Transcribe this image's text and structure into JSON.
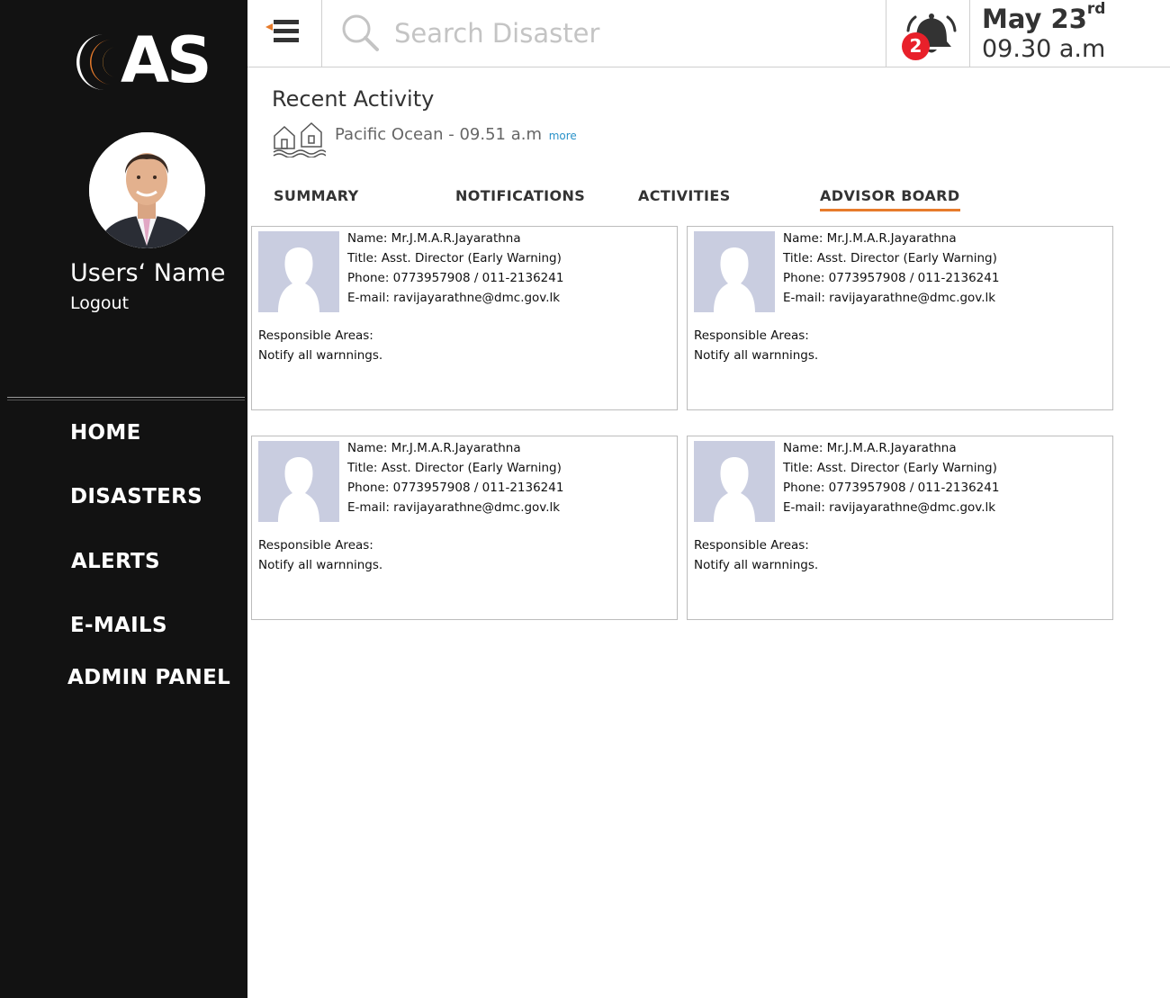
{
  "app": {
    "logo_text": "AS",
    "accent_color": "#e77b2b"
  },
  "sidebar": {
    "user_name": "Users‘  Name",
    "logout_label": "Logout",
    "nav": [
      {
        "label": "HOME"
      },
      {
        "label": "DISASTERS"
      },
      {
        "label": "ALERTS"
      },
      {
        "label": "E-MAILS"
      },
      {
        "label": "ADMIN PANEL"
      }
    ]
  },
  "header": {
    "search_placeholder": "Search Disaster",
    "notification_count": "2",
    "date_main": "May 23",
    "date_suffix": "rd",
    "time": "09.30 a.m"
  },
  "recent_activity": {
    "title": "Recent Activity",
    "item_text": "Pacific Ocean - 09.51 a.m",
    "more_label": "more"
  },
  "tabs": [
    {
      "label": "SUMMARY",
      "active": false
    },
    {
      "label": "NOTIFICATIONS",
      "active": false
    },
    {
      "label": "ACTIVITIES",
      "active": false
    },
    {
      "label": "ADVISOR BOARD",
      "active": true
    }
  ],
  "advisors": [
    {
      "name": "Name: Mr.J.M.A.R.Jayarathna",
      "title": "Title: Asst. Director (Early Warning)",
      "phone": "Phone: 0773957908 / 011-2136241",
      "email": "E-mail: ravijayarathne@dmc.gov.lk",
      "areas_label": "Responsible Areas:",
      "areas": "Notify all warnnings."
    },
    {
      "name": "Name: Mr.J.M.A.R.Jayarathna",
      "title": "Title: Asst. Director (Early Warning)",
      "phone": "Phone: 0773957908 / 011-2136241",
      "email": "E-mail: ravijayarathne@dmc.gov.lk",
      "areas_label": "Responsible Areas:",
      "areas": "Notify all warnnings."
    },
    {
      "name": "Name: Mr.J.M.A.R.Jayarathna",
      "title": "Title: Asst. Director (Early Warning)",
      "phone": "Phone: 0773957908 / 011-2136241",
      "email": "E-mail: ravijayarathne@dmc.gov.lk",
      "areas_label": "Responsible Areas:",
      "areas": "Notify all warnnings."
    },
    {
      "name": "Name: Mr.J.M.A.R.Jayarathna",
      "title": "Title: Asst. Director (Early Warning)",
      "phone": "Phone: 0773957908 / 011-2136241",
      "email": "E-mail: ravijayarathne@dmc.gov.lk",
      "areas_label": "Responsible Areas:",
      "areas": "Notify all warnnings."
    }
  ]
}
